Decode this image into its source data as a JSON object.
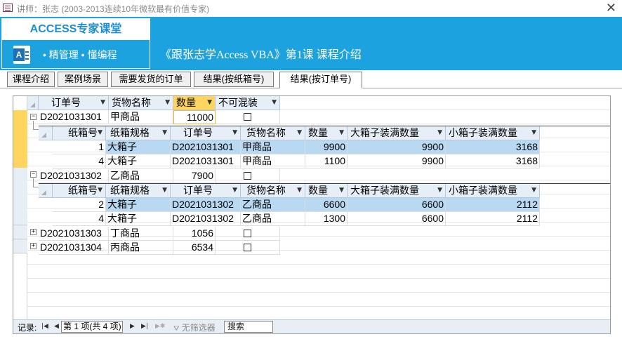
{
  "window": {
    "title": "讲师：张志 (2003-2013连续10年微软最有价值专家)"
  },
  "brand": {
    "title": "ACCESS专家课堂",
    "slogan": "•  精管理  •  懂编程",
    "logo_letter": "A"
  },
  "lesson_title": "《跟张志学Access VBA》第1课 课程介绍",
  "tabs": [
    {
      "label": "课程介绍"
    },
    {
      "label": "案例场景"
    },
    {
      "label": "需要发货的订单"
    },
    {
      "label": "结果(按纸箱号)"
    },
    {
      "label": "结果(按订单号)"
    }
  ],
  "active_tab": 4,
  "main_columns": [
    "订单号",
    "货物名称",
    "数量",
    "不可混装"
  ],
  "sub_columns": [
    "纸箱号",
    "纸箱规格",
    "订单号",
    "货物名称",
    "数量",
    "大箱子装满数量",
    "小箱子装满数量"
  ],
  "orders": [
    {
      "id": "D2021031301",
      "name": "甲商品",
      "qty": "11000",
      "nomix": false,
      "expanded": true,
      "sub": [
        {
          "box": "1",
          "spec": "大箱子",
          "order": "D2021031301",
          "name": "甲商品",
          "qty": "9900",
          "big": "9900",
          "small": "3168"
        },
        {
          "box": "4",
          "spec": "大箱子",
          "order": "D2021031301",
          "name": "甲商品",
          "qty": "1100",
          "big": "9900",
          "small": "3168"
        }
      ]
    },
    {
      "id": "D2021031302",
      "name": "乙商品",
      "qty": "7900",
      "nomix": false,
      "expanded": true,
      "sub": [
        {
          "box": "2",
          "spec": "大箱子",
          "order": "D2021031302",
          "name": "乙商品",
          "qty": "6600",
          "big": "6600",
          "small": "2112"
        },
        {
          "box": "4",
          "spec": "大箱子",
          "order": "D2021031302",
          "name": "乙商品",
          "qty": "1300",
          "big": "6600",
          "small": "2112"
        }
      ]
    },
    {
      "id": "D2021031303",
      "name": "丁商品",
      "qty": "1056",
      "nomix": false,
      "expanded": false
    },
    {
      "id": "D2021031304",
      "name": "丙商品",
      "qty": "6534",
      "nomix": false,
      "expanded": false
    }
  ],
  "navbar": {
    "label": "记录:",
    "record": "第 1 项(共 4 项)",
    "filter": "无筛选器",
    "search": "搜索"
  },
  "colors": {
    "banner": "#1da2e0",
    "selected": "#ffd560",
    "highlight": "#b9d8f2"
  }
}
